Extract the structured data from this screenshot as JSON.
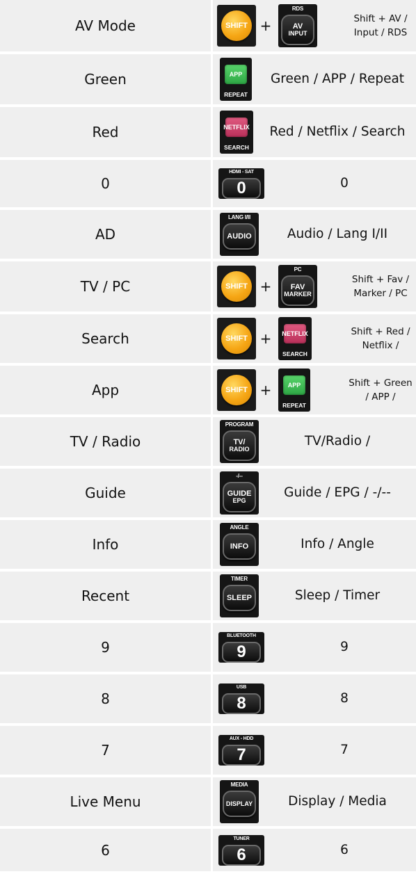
{
  "rows": [
    {
      "name": "AV Mode",
      "desc": "Shift + AV / Input / RDS",
      "buttons": [
        {
          "kind": "shift",
          "label": "SHIFT"
        },
        {
          "kind": "plus",
          "label": "+"
        },
        {
          "kind": "black",
          "top": "RDS",
          "main": "AV",
          "sub": "INPUT",
          "icon": "av-input-button-icon"
        }
      ]
    },
    {
      "name": "Green",
      "desc": "Green / APP / Repeat",
      "buttons": [
        {
          "kind": "green",
          "main": "APP",
          "bottom": "REPEAT",
          "icon": "app-repeat-button-icon"
        }
      ]
    },
    {
      "name": "Red",
      "desc": "Red / Netflix / Search",
      "buttons": [
        {
          "kind": "red",
          "main": "NETFLIX",
          "bottom": "SEARCH",
          "icon": "netflix-search-button-icon"
        }
      ]
    },
    {
      "name": "0",
      "desc": "0",
      "buttons": [
        {
          "kind": "number",
          "top": "HDMI - SAT",
          "main": "0",
          "icon": "zero-key-icon"
        }
      ]
    },
    {
      "name": "AD",
      "desc": "Audio / Lang I/II",
      "buttons": [
        {
          "kind": "black",
          "top": "LANG I/II",
          "main": "AUDIO",
          "icon": "audio-lang-button-icon"
        }
      ]
    },
    {
      "name": "TV / PC",
      "desc": "Shift + Fav / Marker / PC",
      "buttons": [
        {
          "kind": "shift",
          "label": "SHIFT"
        },
        {
          "kind": "plus",
          "label": "+"
        },
        {
          "kind": "black",
          "top": "PC",
          "main": "FAV",
          "sub": "MARKER",
          "icon": "fav-marker-button-icon"
        }
      ]
    },
    {
      "name": "Search",
      "desc": "Shift + Red / Netflix /",
      "buttons": [
        {
          "kind": "shift",
          "label": "SHIFT"
        },
        {
          "kind": "plus",
          "label": "+"
        },
        {
          "kind": "red",
          "main": "NETFLIX",
          "bottom": "SEARCH",
          "icon": "netflix-search-button-icon"
        }
      ]
    },
    {
      "name": "App",
      "desc": "Shift + Green / APP /",
      "buttons": [
        {
          "kind": "shift",
          "label": "SHIFT"
        },
        {
          "kind": "plus",
          "label": "+"
        },
        {
          "kind": "green",
          "main": "APP",
          "bottom": "REPEAT",
          "icon": "app-repeat-button-icon"
        }
      ]
    },
    {
      "name": "TV / Radio",
      "desc": "TV/Radio /",
      "buttons": [
        {
          "kind": "black",
          "top": "PROGRAM",
          "main": "TV/",
          "sub": "RADIO",
          "icon": "tv-radio-button-icon"
        }
      ]
    },
    {
      "name": "Guide",
      "desc": "Guide / EPG / -/--",
      "buttons": [
        {
          "kind": "black",
          "top": "-/--",
          "main": "GUIDE",
          "sub": "EPG",
          "icon": "guide-epg-button-icon"
        }
      ]
    },
    {
      "name": "Info",
      "desc": "Info / Angle",
      "buttons": [
        {
          "kind": "black",
          "top": "ANGLE",
          "main": "INFO",
          "icon": "info-angle-button-icon"
        }
      ]
    },
    {
      "name": "Recent",
      "desc": "Sleep / Timer",
      "buttons": [
        {
          "kind": "black",
          "top": "TIMER",
          "main": "SLEEP",
          "icon": "sleep-timer-button-icon"
        }
      ]
    },
    {
      "name": "9",
      "desc": "9",
      "buttons": [
        {
          "kind": "number",
          "top": "BLUETOOTH",
          "main": "9",
          "icon": "nine-key-icon"
        }
      ]
    },
    {
      "name": "8",
      "desc": "8",
      "buttons": [
        {
          "kind": "number",
          "top": "USB",
          "main": "8",
          "icon": "eight-key-icon"
        }
      ]
    },
    {
      "name": "7",
      "desc": "7",
      "buttons": [
        {
          "kind": "number",
          "top": "AUX - HDD",
          "main": "7",
          "icon": "seven-key-icon"
        }
      ]
    },
    {
      "name": "Live Menu",
      "desc": "Display / Media",
      "buttons": [
        {
          "kind": "black",
          "top": "MEDIA",
          "main": "DISPLAY",
          "icon": "display-media-button-icon"
        }
      ]
    },
    {
      "name": "6",
      "desc": "6",
      "buttons": [
        {
          "kind": "number",
          "top": "TUNER",
          "main": "6",
          "icon": "six-key-icon"
        }
      ]
    }
  ]
}
